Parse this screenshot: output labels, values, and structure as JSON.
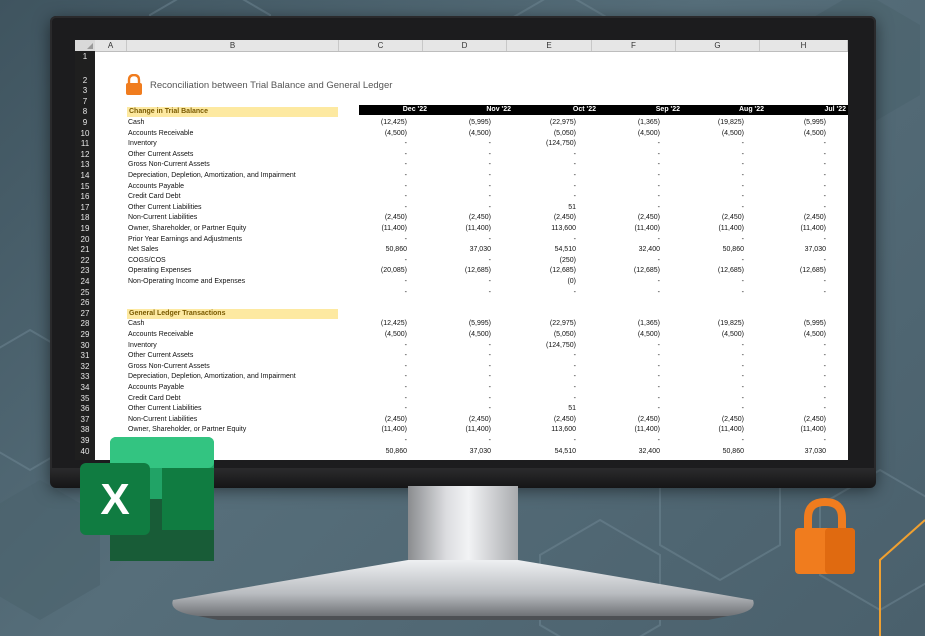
{
  "sheet": {
    "title": "Reconciliation between Trial Balance and General Ledger",
    "columns": [
      "A",
      "B",
      "C",
      "D",
      "E",
      "F",
      "G",
      "H"
    ],
    "rows": [
      "1",
      "2",
      "3",
      "7",
      "8",
      "9",
      "10",
      "11",
      "12",
      "13",
      "14",
      "15",
      "16",
      "17",
      "18",
      "19",
      "20",
      "21",
      "22",
      "23",
      "24",
      "25",
      "26",
      "27",
      "28",
      "29",
      "30",
      "31",
      "32",
      "33",
      "34",
      "35",
      "36",
      "37",
      "38",
      "39",
      "40"
    ],
    "months": [
      "Dec '22",
      "Nov '22",
      "Oct '22",
      "Sep '22",
      "Aug '22",
      "Jul '22"
    ],
    "section1": {
      "title": "Change in Trial Balance",
      "lines": [
        {
          "label": "Cash",
          "values": [
            "(12,425)",
            "(5,995)",
            "(22,975)",
            "(1,365)",
            "(19,825)",
            "(5,995)"
          ]
        },
        {
          "label": "Accounts Receivable",
          "values": [
            "(4,500)",
            "(4,500)",
            "(5,050)",
            "(4,500)",
            "(4,500)",
            "(4,500)"
          ]
        },
        {
          "label": "Inventory",
          "values": [
            "-",
            "-",
            "(124,750)",
            "-",
            "-",
            "-"
          ]
        },
        {
          "label": "Other Current Assets",
          "values": [
            "-",
            "-",
            "-",
            "-",
            "-",
            "-"
          ]
        },
        {
          "label": "Gross Non-Current Assets",
          "values": [
            "-",
            "-",
            "-",
            "-",
            "-",
            "-"
          ]
        },
        {
          "label": "Depreciation, Depletion, Amortization, and Impairment",
          "values": [
            "-",
            "-",
            "-",
            "-",
            "-",
            "-"
          ]
        },
        {
          "label": "Accounts Payable",
          "values": [
            "-",
            "-",
            "-",
            "-",
            "-",
            "-"
          ]
        },
        {
          "label": "Credit Card Debt",
          "values": [
            "-",
            "-",
            "-",
            "-",
            "-",
            "-"
          ]
        },
        {
          "label": "Other Current Liabilities",
          "values": [
            "-",
            "-",
            "51",
            "-",
            "-",
            "-"
          ]
        },
        {
          "label": "Non-Current Liabilities",
          "values": [
            "(2,450)",
            "(2,450)",
            "(2,450)",
            "(2,450)",
            "(2,450)",
            "(2,450)"
          ]
        },
        {
          "label": "Owner, Shareholder, or Partner Equity",
          "values": [
            "(11,400)",
            "(11,400)",
            "113,600",
            "(11,400)",
            "(11,400)",
            "(11,400)"
          ]
        },
        {
          "label": "Prior Year Earnings and Adjustments",
          "values": [
            "-",
            "-",
            "-",
            "-",
            "-",
            "-"
          ]
        },
        {
          "label": "Net Sales",
          "values": [
            "50,860",
            "37,030",
            "54,510",
            "32,400",
            "50,860",
            "37,030"
          ]
        },
        {
          "label": "COGS/COS",
          "values": [
            "-",
            "-",
            "(250)",
            "-",
            "-",
            "-"
          ]
        },
        {
          "label": "Operating Expenses",
          "values": [
            "(20,085)",
            "(12,685)",
            "(12,685)",
            "(12,685)",
            "(12,685)",
            "(12,685)"
          ]
        },
        {
          "label": "Non-Operating Income and Expenses",
          "values": [
            "-",
            "-",
            "(0)",
            "-",
            "-",
            "-"
          ]
        },
        {
          "label": "",
          "values": [
            "-",
            "-",
            "-",
            "-",
            "-",
            "-"
          ]
        }
      ]
    },
    "section2": {
      "title": "General Ledger Transactions",
      "lines": [
        {
          "label": "Cash",
          "values": [
            "(12,425)",
            "(5,995)",
            "(22,975)",
            "(1,365)",
            "(19,825)",
            "(5,995)"
          ]
        },
        {
          "label": "Accounts Receivable",
          "values": [
            "(4,500)",
            "(4,500)",
            "(5,050)",
            "(4,500)",
            "(4,500)",
            "(4,500)"
          ]
        },
        {
          "label": "Inventory",
          "values": [
            "-",
            "-",
            "(124,750)",
            "-",
            "-",
            "-"
          ]
        },
        {
          "label": "Other Current Assets",
          "values": [
            "-",
            "-",
            "-",
            "-",
            "-",
            "-"
          ]
        },
        {
          "label": "Gross Non-Current Assets",
          "values": [
            "-",
            "-",
            "-",
            "-",
            "-",
            "-"
          ]
        },
        {
          "label": "Depreciation, Depletion, Amortization, and Impairment",
          "values": [
            "-",
            "-",
            "-",
            "-",
            "-",
            "-"
          ]
        },
        {
          "label": "Accounts Payable",
          "values": [
            "-",
            "-",
            "-",
            "-",
            "-",
            "-"
          ]
        },
        {
          "label": "Credit Card Debt",
          "values": [
            "-",
            "-",
            "-",
            "-",
            "-",
            "-"
          ]
        },
        {
          "label": "Other Current Liabilities",
          "values": [
            "-",
            "-",
            "51",
            "-",
            "-",
            "-"
          ]
        },
        {
          "label": "Non-Current Liabilities",
          "values": [
            "(2,450)",
            "(2,450)",
            "(2,450)",
            "(2,450)",
            "(2,450)",
            "(2,450)"
          ]
        },
        {
          "label": "Owner, Shareholder, or Partner Equity",
          "values": [
            "(11,400)",
            "(11,400)",
            "113,600",
            "(11,400)",
            "(11,400)",
            "(11,400)"
          ]
        },
        {
          "label": "ustments",
          "values": [
            "-",
            "-",
            "-",
            "-",
            "-",
            "-"
          ]
        },
        {
          "label": "",
          "values": [
            "50,860",
            "37,030",
            "54,510",
            "32,400",
            "50,860",
            "37,030"
          ]
        }
      ]
    },
    "colors": {
      "section_fill": "#fde9a1",
      "header_fill": "#000000",
      "accent": "#f07c1e"
    }
  },
  "branding": {
    "excel_logo_letter": "X",
    "icons": [
      "excel-logo-icon",
      "padlock-icon"
    ]
  }
}
